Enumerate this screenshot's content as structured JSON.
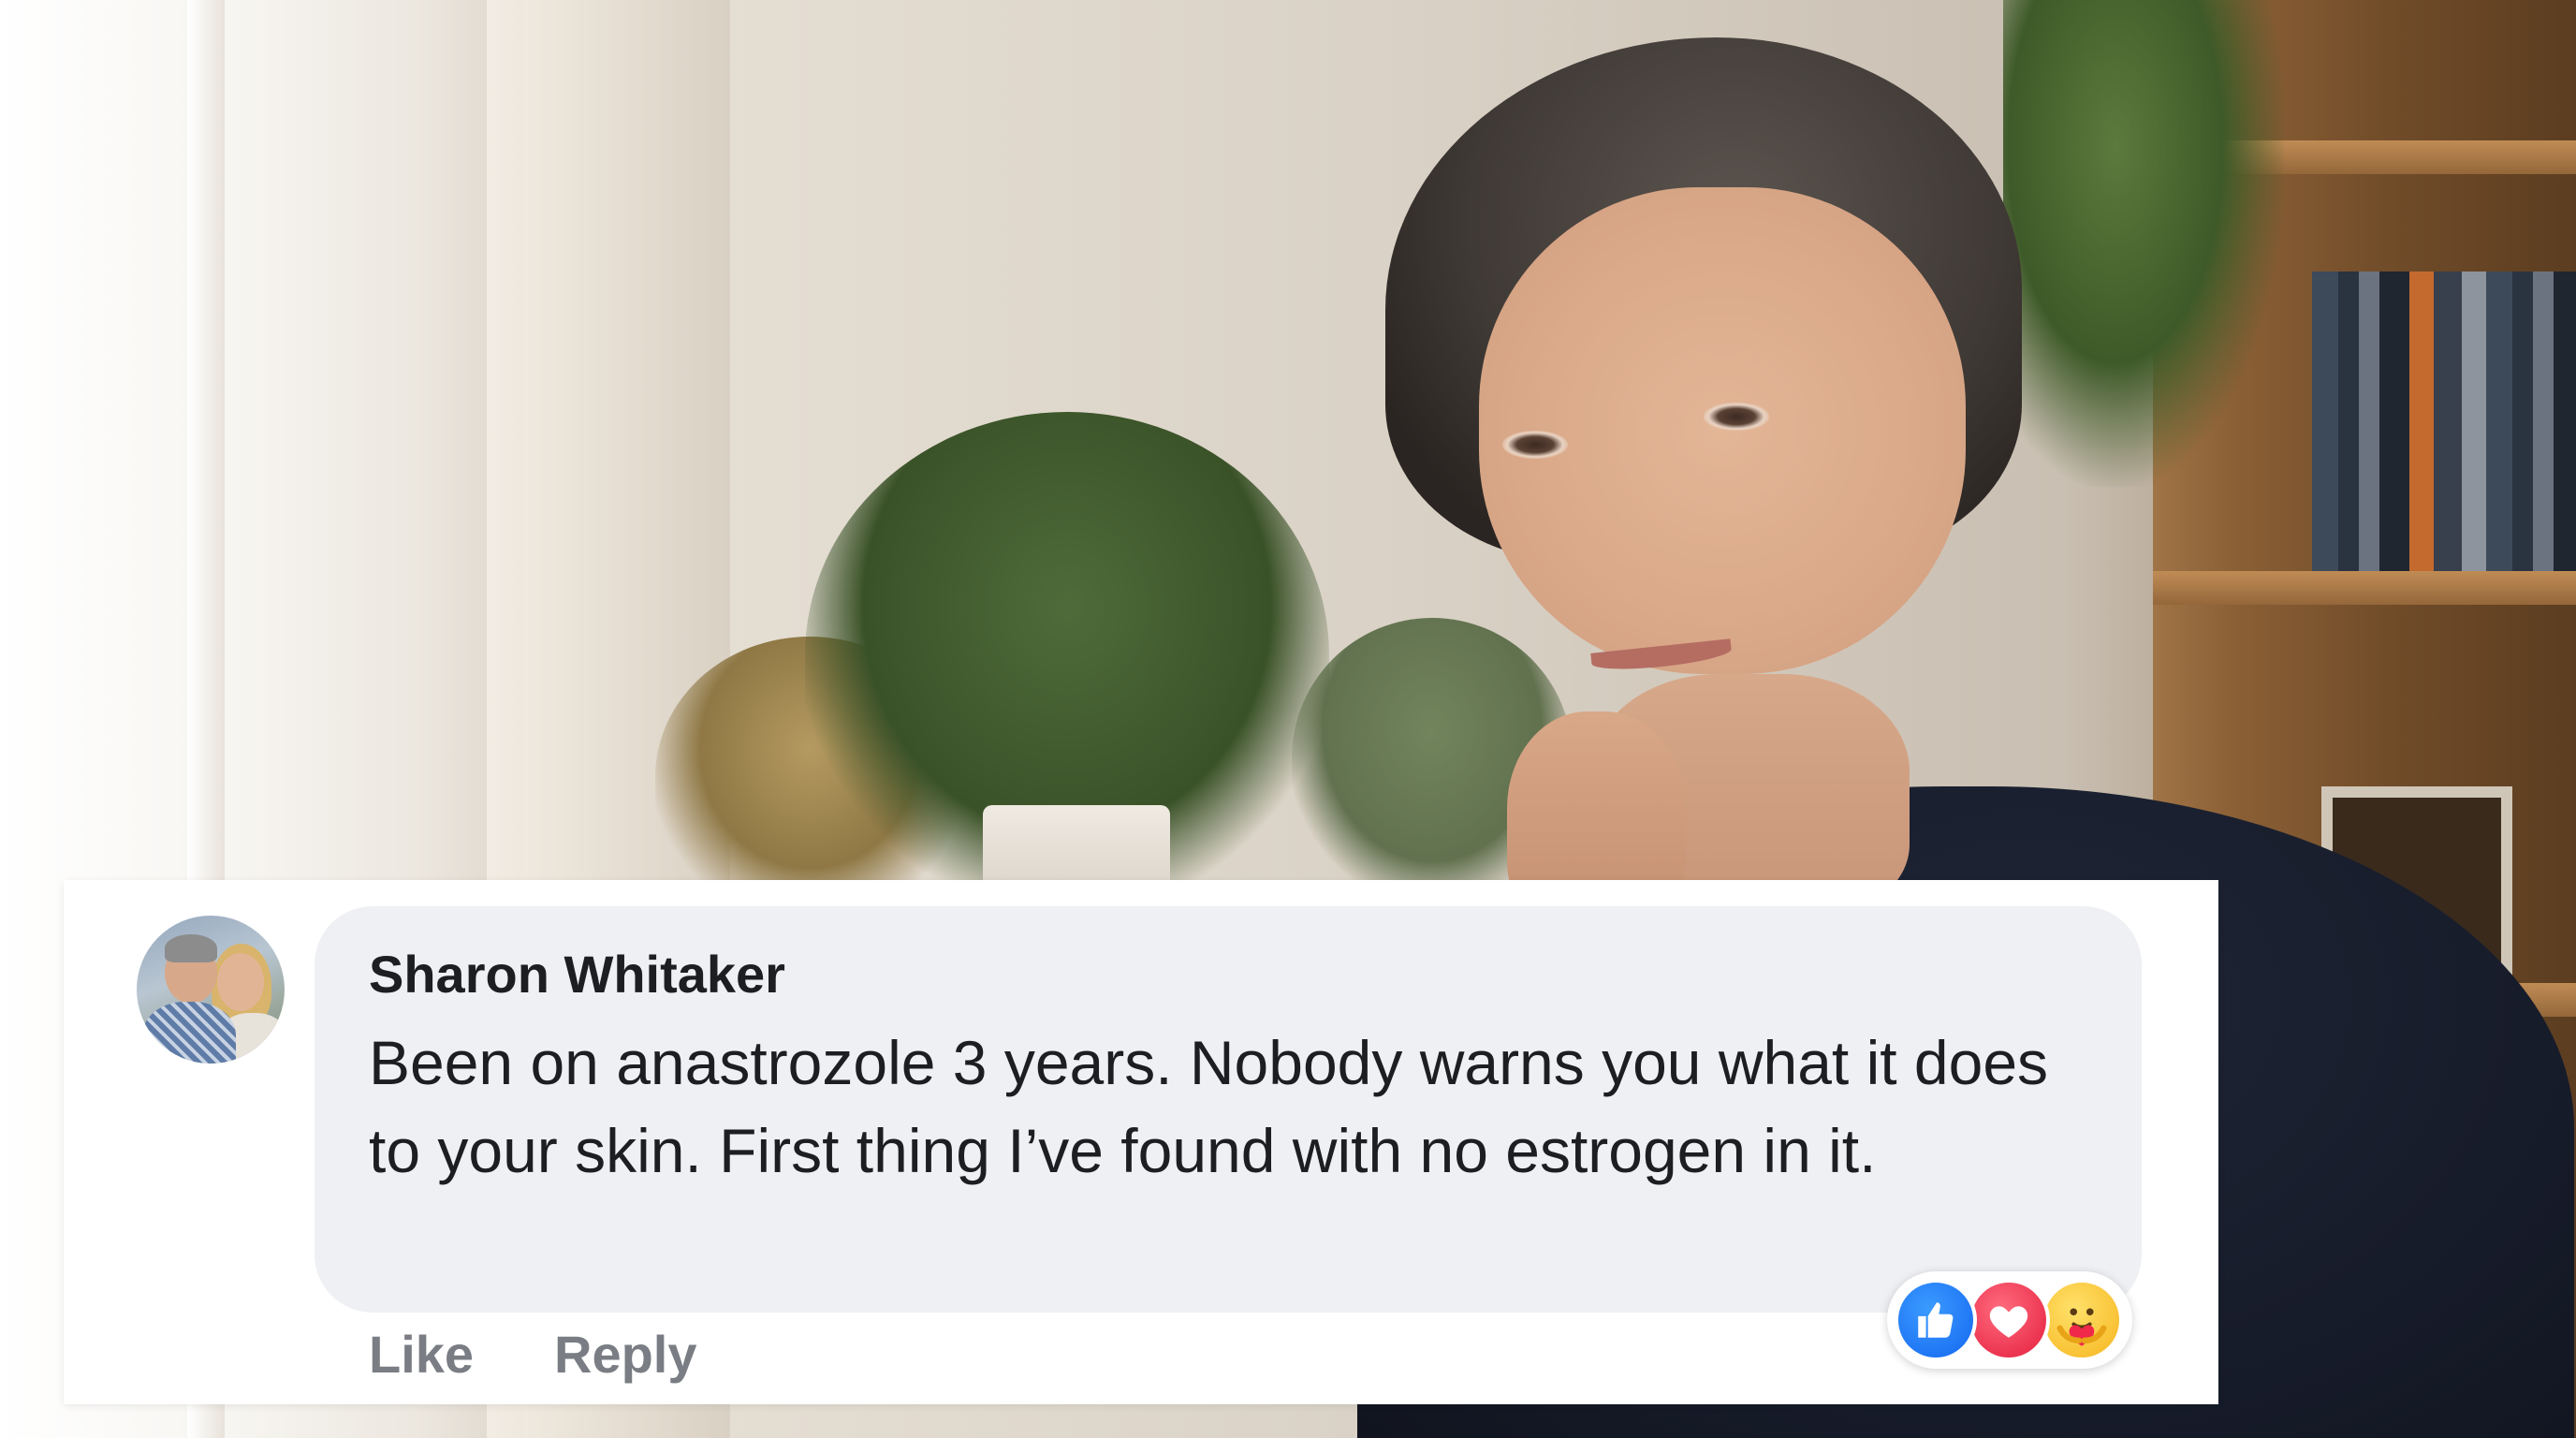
{
  "comment": {
    "author": "Sharon Whitaker",
    "text": "Been on anastrozole 3 years. Nobody warns you what it does to your skin. First thing I’ve found with no estrogen in it.",
    "actions": {
      "like_label": "Like",
      "reply_label": "Reply"
    },
    "reactions": [
      {
        "icon": "thumbs-up-icon",
        "color": "#1877f2"
      },
      {
        "icon": "heart-icon",
        "color": "#f02849"
      },
      {
        "icon": "care-hug-icon",
        "color": "#f7b928"
      }
    ]
  },
  "colors": {
    "bubble_bg": "#eff0f4",
    "text": "#1c1e21",
    "action_text": "#7a7d83"
  }
}
